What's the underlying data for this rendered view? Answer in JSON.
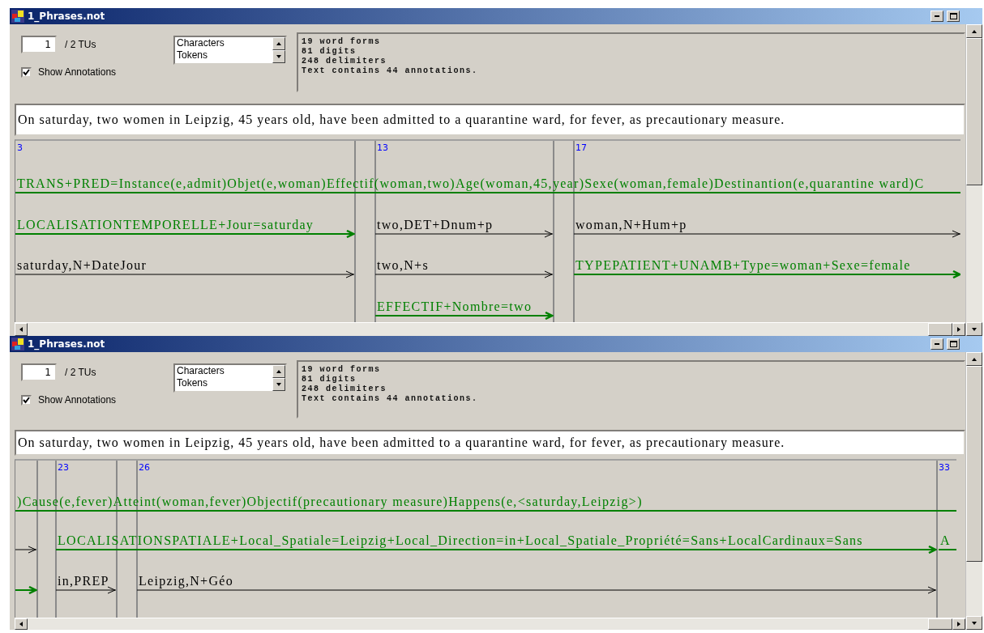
{
  "windows": [
    {
      "title": "1_Phrases.not",
      "tu_value": "1",
      "tu_total": "/ 2 TUs",
      "show_annotations": {
        "label": "Show Annotations",
        "checked": true
      },
      "units": [
        {
          "label": "Characters",
          "selected": false
        },
        {
          "label": "Tokens",
          "selected": false
        }
      ],
      "stats": [
        "19 word forms",
        "81 digits",
        "248 delimiters",
        "Text contains 44 annotations."
      ],
      "sentence": "On saturday, two women in Leipzig, 45 years old, have been admitted to a quarantine ward, for fever, as precautionary measure.",
      "canvas": {
        "columns": [
          {
            "number": "3"
          },
          {
            "number": "13"
          },
          {
            "number": "17"
          }
        ],
        "annotations": [
          {
            "kind": "semantic",
            "text": "TRANS+PRED=Instance(e,admit)Objet(e,woman)Effectif(woman,two)Age(woman,45,year)Sexe(woman,female)Destinantion(e,quarantine ward)C",
            "arrow": false
          },
          {
            "kind": "semantic",
            "text": "LOCALISATIONTEMPORELLE+Jour=saturday",
            "arrow": true
          },
          {
            "kind": "lexical",
            "text": "two,DET+Dnum+p",
            "arrow": true
          },
          {
            "kind": "lexical",
            "text": "woman,N+Hum+p",
            "arrow": true
          },
          {
            "kind": "lexical",
            "text": "saturday,N+DateJour",
            "arrow": true
          },
          {
            "kind": "lexical",
            "text": "two,N+s",
            "arrow": true
          },
          {
            "kind": "semantic",
            "text": "TYPEPATIENT+UNAMB+Type=woman+Sexe=female",
            "arrow": true
          },
          {
            "kind": "semantic",
            "text": "EFFECTIF+Nombre=two",
            "arrow": true
          }
        ]
      }
    },
    {
      "title": "1_Phrases.not",
      "tu_value": "1",
      "tu_total": "/ 2 TUs",
      "show_annotations": {
        "label": "Show Annotations",
        "checked": true
      },
      "units": [
        {
          "label": "Characters",
          "selected": false
        },
        {
          "label": "Tokens",
          "selected": false
        }
      ],
      "stats": [
        "19 word forms",
        "81 digits",
        "248 delimiters",
        "Text contains 44 annotations."
      ],
      "sentence": "On saturday, two women in Leipzig, 45 years old, have been admitted to a quarantine ward, for fever, as precautionary measure.",
      "canvas": {
        "columns": [
          {
            "number": "23"
          },
          {
            "number": "26"
          },
          {
            "number": "33"
          }
        ],
        "annotations": [
          {
            "kind": "semantic",
            "text": ")Cause(e,fever)Atteint(woman,fever)Objectif(precautionary measure)Happens(e,<saturday,Leipzig>)",
            "arrow": false
          },
          {
            "kind": "lexical",
            "arrow": true
          },
          {
            "kind": "semantic",
            "text": "LOCALISATIONSPATIALE+Local_Spatiale=Leipzig+Local_Direction=in+Local_Spatiale_Propriété=Sans+LocalCardinaux=Sans",
            "arrow": true
          },
          {
            "kind": "semantic",
            "text": "A",
            "arrow": false
          },
          {
            "kind": "semantic",
            "arrow": true
          },
          {
            "kind": "lexical",
            "text": "in,PREP",
            "arrow": true
          },
          {
            "kind": "lexical",
            "text": "Leipzig,N+Géo",
            "arrow": true
          }
        ]
      }
    }
  ]
}
